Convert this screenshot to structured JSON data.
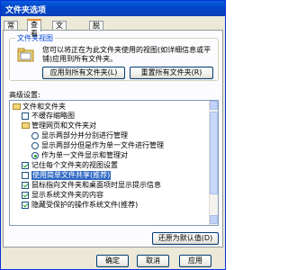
{
  "window": {
    "title": "文件夹选项"
  },
  "tabs": [
    {
      "label": "常规"
    },
    {
      "label": "查看"
    },
    {
      "label": "文件类型"
    },
    {
      "label": "脱机文件"
    }
  ],
  "folder_views": {
    "group_title": "文件夹视图",
    "description": "您可以将正在为此文件夹使用的视图(如详细信息或平铺)应用到所有文件夹。",
    "apply_all_label": "应用到所有文件夹(L)",
    "reset_all_label": "重置所有文件夹(R)"
  },
  "advanced": {
    "label": "高级设置:",
    "items": [
      {
        "type": "folder",
        "text": "文件和文件夹"
      },
      {
        "type": "checkbox",
        "checked": false,
        "text": "不缓存缩略图"
      },
      {
        "type": "folder",
        "text": "管理网页和文件夹对"
      },
      {
        "type": "radio",
        "checked": false,
        "text": "显示两部分并分别进行管理"
      },
      {
        "type": "radio",
        "checked": false,
        "text": "显示两部分但是作为单一文件进行管理"
      },
      {
        "type": "radio",
        "checked": true,
        "text": "作为单一文件显示和管理对"
      },
      {
        "type": "checkbox",
        "checked": true,
        "text": "记住每个文件夹的视图设置"
      },
      {
        "type": "checkbox",
        "checked": false,
        "text": "使用简单文件共享(推荐)",
        "highlight": true
      },
      {
        "type": "checkbox",
        "checked": true,
        "text": "鼠标指向文件夹和桌面项时显示提示信息"
      },
      {
        "type": "checkbox",
        "checked": true,
        "text": "显示系统文件夹的内容"
      },
      {
        "type": "checkbox",
        "checked": true,
        "text": "隐藏受保护的操作系统文件(推荐)"
      }
    ],
    "restore_label": "还原为默认值(D)"
  },
  "buttons": {
    "ok": "确定",
    "cancel": "取消",
    "apply": "应用"
  },
  "colors": {
    "title_bar": "#0a5fe0",
    "selection": "#316ac5",
    "check": "#21a121"
  }
}
